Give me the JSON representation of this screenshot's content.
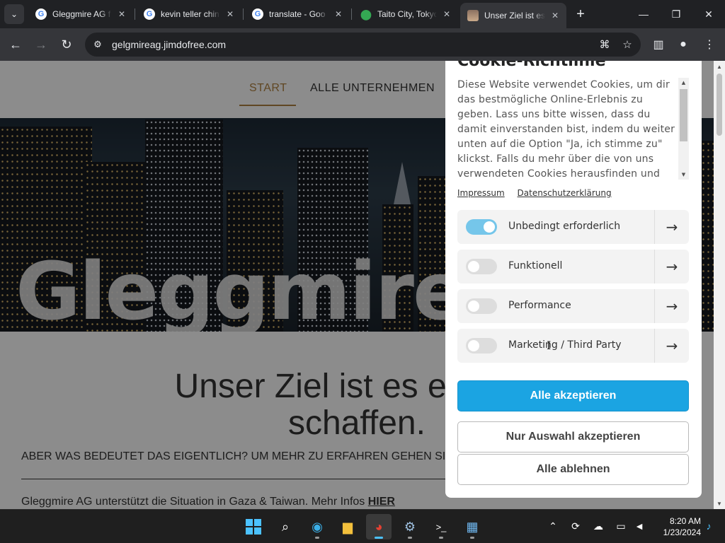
{
  "browser": {
    "tabs": [
      {
        "title": "Gleggmire AG f",
        "icon": "google-icon",
        "active": false
      },
      {
        "title": "kevin teller chin",
        "icon": "google-icon",
        "active": false
      },
      {
        "title": "translate - Goo",
        "icon": "google-icon",
        "active": false
      },
      {
        "title": "Taito City, Tokyo",
        "icon": "maps-pin-icon",
        "active": false
      },
      {
        "title": "Unser Ziel ist es",
        "icon": "site-photo-icon",
        "active": true
      }
    ],
    "url": "gelgmireag.jimdofree.com"
  },
  "site": {
    "nav": {
      "start": "START",
      "companies": "ALLE UNTERNEHMEN"
    },
    "hero_title": "Gleggmire",
    "headline_line1": "Unser Ziel ist es eine be",
    "headline_line2": "schaffen.",
    "subline": "ABER WAS BEDEUTET DAS EIGENTLICH? UM MEHR ZU ERFAHREN GEHEN SI",
    "body_text": "Gleggmire AG unterstützt die Situation in Gaza & Taiwan. Mehr Infos ",
    "body_link": "HIER"
  },
  "cookie_dialog": {
    "title": "Cookie-Richtlinie",
    "text": "Diese Website verwendet Cookies, um dir das bestmögliche Online-Erlebnis zu geben. Lass uns bitte wissen, dass du damit einverstanden bist, indem du weiter unten auf die Option \"Ja, ich stimme zu\" klickst. Falls du mehr über die von uns verwendeten Cookies herausfinden und",
    "links": {
      "imprint": "Impressum",
      "privacy": "Datenschutzerklärung"
    },
    "categories": [
      {
        "label": "Unbedingt erforderlich",
        "enabled": true
      },
      {
        "label": "Funktionell",
        "enabled": false
      },
      {
        "label": "Performance",
        "enabled": false
      },
      {
        "label": "Marketing / Third Party",
        "enabled": false
      }
    ],
    "buttons": {
      "accept_all": "Alle akzeptieren",
      "accept_selection": "Nur Auswahl akzeptieren",
      "reject_all": "Alle ablehnen"
    }
  },
  "taskbar": {
    "time": "8:20 AM",
    "date": "1/23/2024"
  },
  "colors": {
    "accent_nav": "#b08140",
    "cookie_primary": "#1ba4e2",
    "toggle_on": "#75c6ea",
    "taskbar_accent": "#4cc2ff"
  }
}
